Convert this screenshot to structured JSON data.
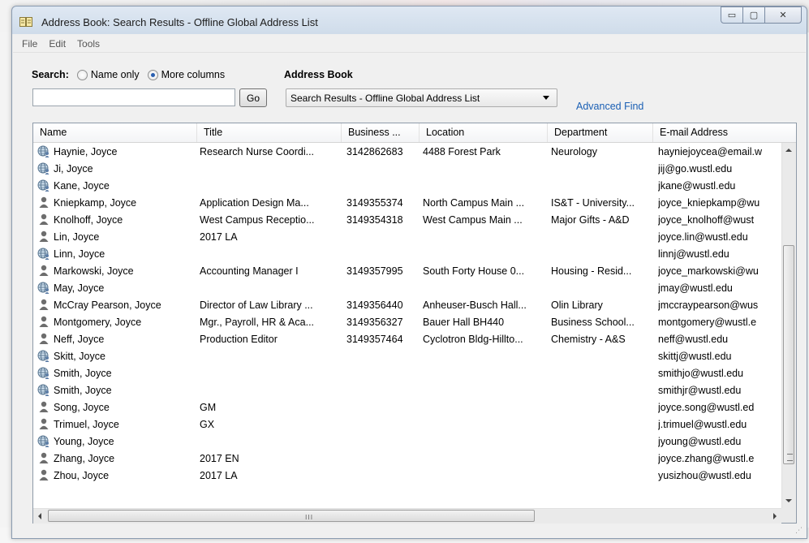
{
  "window": {
    "title": "Address Book: Search Results - Offline Global Address List",
    "min_glyph": "▭",
    "max_glyph": "▢",
    "close_glyph": "✕"
  },
  "menu": [
    "File",
    "Edit",
    "Tools"
  ],
  "search": {
    "label": "Search:",
    "option_name_only": "Name only",
    "option_more_columns": "More columns",
    "selected": "More columns",
    "input_value": "",
    "go_label": "Go"
  },
  "address_book": {
    "label": "Address Book",
    "selected": "Search Results - Offline Global Address List",
    "advanced_find": "Advanced Find"
  },
  "columns": [
    "Name",
    "Title",
    "Business ...",
    "Location",
    "Department",
    "E-mail Address"
  ],
  "rows": [
    {
      "icon": "globe-contact-icon",
      "name": "Haynie, Joyce",
      "title": "Research Nurse Coordi...",
      "phone": "3142862683",
      "location": "4488 Forest Park",
      "department": "Neurology",
      "email": "hayniejoycea@email.w"
    },
    {
      "icon": "globe-contact-icon",
      "name": "Ji, Joyce",
      "title": "",
      "phone": "",
      "location": "",
      "department": "",
      "email": "jij@go.wustl.edu"
    },
    {
      "icon": "globe-contact-icon",
      "name": "Kane, Joyce",
      "title": "",
      "phone": "",
      "location": "",
      "department": "",
      "email": "jkane@wustl.edu"
    },
    {
      "icon": "person-icon",
      "name": "Kniepkamp, Joyce",
      "title": "Application Design Ma...",
      "phone": "3149355374",
      "location": "North Campus Main ...",
      "department": "IS&T - University...",
      "email": "joyce_kniepkamp@wu"
    },
    {
      "icon": "person-icon",
      "name": "Knolhoff, Joyce",
      "title": "West Campus Receptio...",
      "phone": "3149354318",
      "location": "West Campus Main ...",
      "department": "Major Gifts - A&D",
      "email": "joyce_knolhoff@wust"
    },
    {
      "icon": "person-icon",
      "name": "Lin, Joyce",
      "title": "2017 LA",
      "phone": "",
      "location": "",
      "department": "",
      "email": "joyce.lin@wustl.edu"
    },
    {
      "icon": "globe-contact-icon",
      "name": "Linn, Joyce",
      "title": "",
      "phone": "",
      "location": "",
      "department": "",
      "email": "linnj@wustl.edu"
    },
    {
      "icon": "person-icon",
      "name": "Markowski, Joyce",
      "title": "Accounting Manager I",
      "phone": "3149357995",
      "location": "South Forty House 0...",
      "department": "Housing - Resid...",
      "email": "joyce_markowski@wu"
    },
    {
      "icon": "globe-contact-icon",
      "name": "May, Joyce",
      "title": "",
      "phone": "",
      "location": "",
      "department": "",
      "email": "jmay@wustl.edu"
    },
    {
      "icon": "person-icon",
      "name": "McCray Pearson, Joyce",
      "title": "Director of Law Library ...",
      "phone": "3149356440",
      "location": "Anheuser-Busch Hall...",
      "department": "Olin Library",
      "email": "jmccraypearson@wus"
    },
    {
      "icon": "person-icon",
      "name": "Montgomery, Joyce",
      "title": "Mgr., Payroll, HR & Aca...",
      "phone": "3149356327",
      "location": "Bauer Hall BH440",
      "department": "Business School...",
      "email": "montgomery@wustl.e"
    },
    {
      "icon": "person-icon",
      "name": "Neff, Joyce",
      "title": "Production Editor",
      "phone": "3149357464",
      "location": "Cyclotron Bldg-Hillto...",
      "department": "Chemistry - A&S",
      "email": "neff@wustl.edu"
    },
    {
      "icon": "globe-contact-icon",
      "name": "Skitt, Joyce",
      "title": "",
      "phone": "",
      "location": "",
      "department": "",
      "email": "skittj@wustl.edu"
    },
    {
      "icon": "globe-contact-icon",
      "name": "Smith, Joyce",
      "title": "",
      "phone": "",
      "location": "",
      "department": "",
      "email": "smithjo@wustl.edu"
    },
    {
      "icon": "globe-contact-icon",
      "name": "Smith, Joyce",
      "title": "",
      "phone": "",
      "location": "",
      "department": "",
      "email": "smithjr@wustl.edu"
    },
    {
      "icon": "person-icon",
      "name": "Song, Joyce",
      "title": "GM",
      "phone": "",
      "location": "",
      "department": "",
      "email": "joyce.song@wustl.ed"
    },
    {
      "icon": "person-icon",
      "name": "Trimuel, Joyce",
      "title": "GX",
      "phone": "",
      "location": "",
      "department": "",
      "email": "j.trimuel@wustl.edu"
    },
    {
      "icon": "globe-contact-icon",
      "name": "Young, Joyce",
      "title": "",
      "phone": "",
      "location": "",
      "department": "",
      "email": "jyoung@wustl.edu"
    },
    {
      "icon": "person-icon",
      "name": "Zhang, Joyce",
      "title": "2017 EN",
      "phone": "",
      "location": "",
      "department": "",
      "email": "joyce.zhang@wustl.e"
    },
    {
      "icon": "person-icon",
      "name": "Zhou, Joyce",
      "title": "2017 LA",
      "phone": "",
      "location": "",
      "department": "",
      "email": "yusizhou@wustl.edu"
    }
  ],
  "scroll_grip": "III"
}
